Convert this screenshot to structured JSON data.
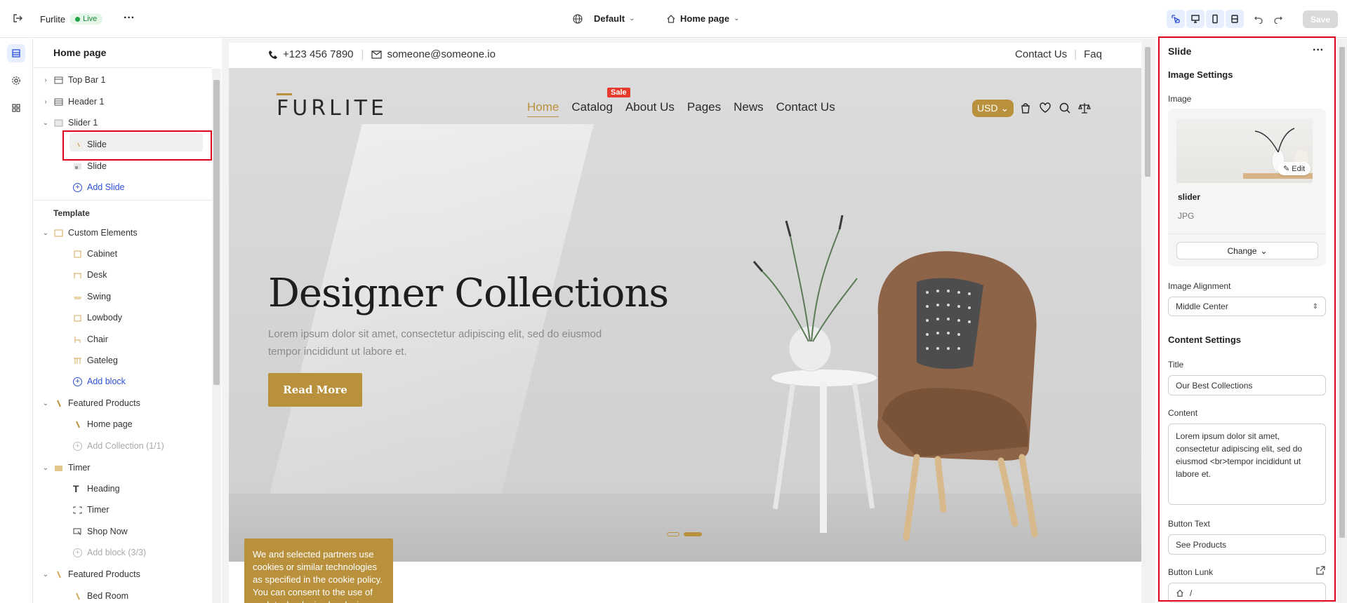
{
  "topbar": {
    "site_name": "Furlite",
    "status": "Live",
    "theme": "Default",
    "page": "Home page",
    "save_label": "Save"
  },
  "tree": {
    "title": "Home page",
    "sections": [
      {
        "label": "Top Bar 1"
      },
      {
        "label": "Header 1"
      },
      {
        "label": "Slider 1"
      }
    ],
    "slider_children": [
      "Slide",
      "Slide"
    ],
    "add_slide": "Add Slide",
    "template_label": "Template",
    "custom_elements": {
      "label": "Custom Elements",
      "children": [
        "Cabinet",
        "Desk",
        "Swing",
        "Lowbody",
        "Chair",
        "Gateleg"
      ],
      "add": "Add block"
    },
    "featured_products": {
      "label": "Featured Products",
      "children": [
        "Home page"
      ],
      "add": "Add Collection (1/1)"
    },
    "timer": {
      "label": "Timer",
      "children": [
        "Heading",
        "Timer",
        "Shop Now"
      ],
      "add": "Add block (3/3)"
    },
    "featured_products_2": {
      "label": "Featured Products",
      "children": [
        "Bed Room"
      ]
    }
  },
  "site": {
    "phone": "+123 456 7890",
    "email": "someone@someone.io",
    "top_links": [
      "Contact Us",
      "Faq"
    ],
    "logo": "FURLITE",
    "nav": [
      "Home",
      "Catalog",
      "About Us",
      "Pages",
      "News",
      "Contact Us"
    ],
    "sale_badge": "Sale",
    "currency": "USD",
    "headline": "Designer Collections",
    "subtext": "Lorem ipsum dolor sit amet, consectetur adipiscing elit, sed do eiusmod tempor incididunt ut labore et.",
    "button": "Read More",
    "cookie": "We and selected partners use cookies or similar technologies as specified in the cookie policy. You can consent to the use of such technologies by closing this notice, by i..."
  },
  "panel": {
    "title": "Slide",
    "image_settings": "Image Settings",
    "image_label": "Image",
    "edit": "Edit",
    "image_name": "slider",
    "image_type": "JPG",
    "change": "Change",
    "alignment_label": "Image Alignment",
    "alignment_value": "Middle Center",
    "content_settings": "Content Settings",
    "title_label": "Title",
    "title_value": "Our Best Collections",
    "content_label": "Content",
    "content_value": "Lorem ipsum dolor sit amet, consectetur adipiscing elit, sed do eiusmod <br>tempor incididunt ut labore et.",
    "button_text_label": "Button Text",
    "button_text_value": "See Products",
    "button_link_label": "Button Lunk",
    "button_link_value": "/"
  },
  "colors": {
    "accent": "#b9913d",
    "highlight": "#e0001b",
    "link": "#2c4fd8"
  }
}
